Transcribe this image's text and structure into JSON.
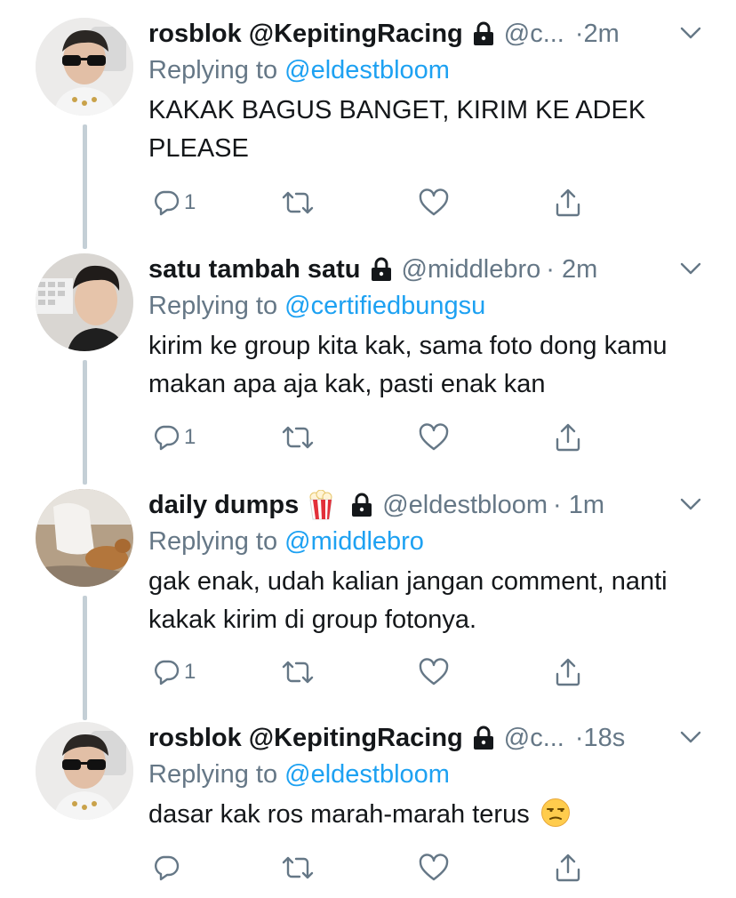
{
  "colors": {
    "link": "#1da1f2",
    "secondary": "#657786",
    "text": "#14171a",
    "thread_line": "#c4cfd6"
  },
  "tweets": [
    {
      "name": "rosblok @KepitingRacing",
      "name_emoji": null,
      "handle": "@c...",
      "time": "·2m",
      "replying_label": "Replying to",
      "replying_to": "@eldestbloom",
      "text": "KAKAK BAGUS BANGET, KIRIM KE ADEK PLEASE",
      "reply_count": "1",
      "text_emoji": null
    },
    {
      "name": "satu tambah satu",
      "name_emoji": null,
      "handle": "@middlebro",
      "time": "· 2m",
      "replying_label": "Replying to",
      "replying_to": "@certifiedbungsu",
      "text": "kirim ke group kita kak, sama foto dong kamu makan apa aja kak, pasti enak kan",
      "reply_count": "1",
      "text_emoji": null
    },
    {
      "name": "daily dumps",
      "name_emoji": "popcorn",
      "handle": "@eldestbloom",
      "time": "· 1m",
      "replying_label": "Replying to",
      "replying_to": "@middlebro",
      "text": "gak enak, udah kalian jangan comment, nanti kakak kirim di group fotonya.",
      "reply_count": "1",
      "text_emoji": null
    },
    {
      "name": "rosblok @KepitingRacing",
      "name_emoji": null,
      "handle": "@c...",
      "time": "·18s",
      "replying_label": "Replying to",
      "replying_to": "@eldestbloom",
      "text": "dasar kak ros marah-marah terus",
      "reply_count": "",
      "text_emoji": "unamused-face"
    }
  ]
}
